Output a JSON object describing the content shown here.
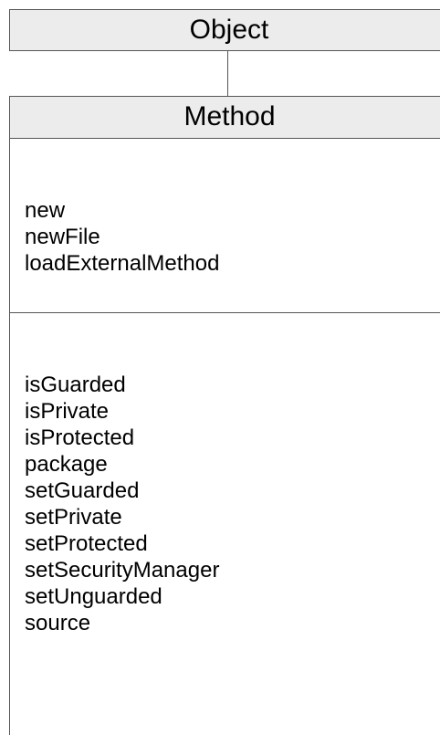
{
  "parent_class": {
    "name": "Object"
  },
  "class": {
    "name": "Method",
    "class_methods": [
      "new",
      "newFile",
      "loadExternalMethod"
    ],
    "instance_methods": [
      "isGuarded",
      "isPrivate",
      "isProtected",
      "package",
      "setGuarded",
      "setPrivate",
      "setProtected",
      "setSecurityManager",
      "setUnguarded",
      "source"
    ]
  },
  "colors": {
    "header_fill": "#ececec",
    "border": "#555555"
  }
}
